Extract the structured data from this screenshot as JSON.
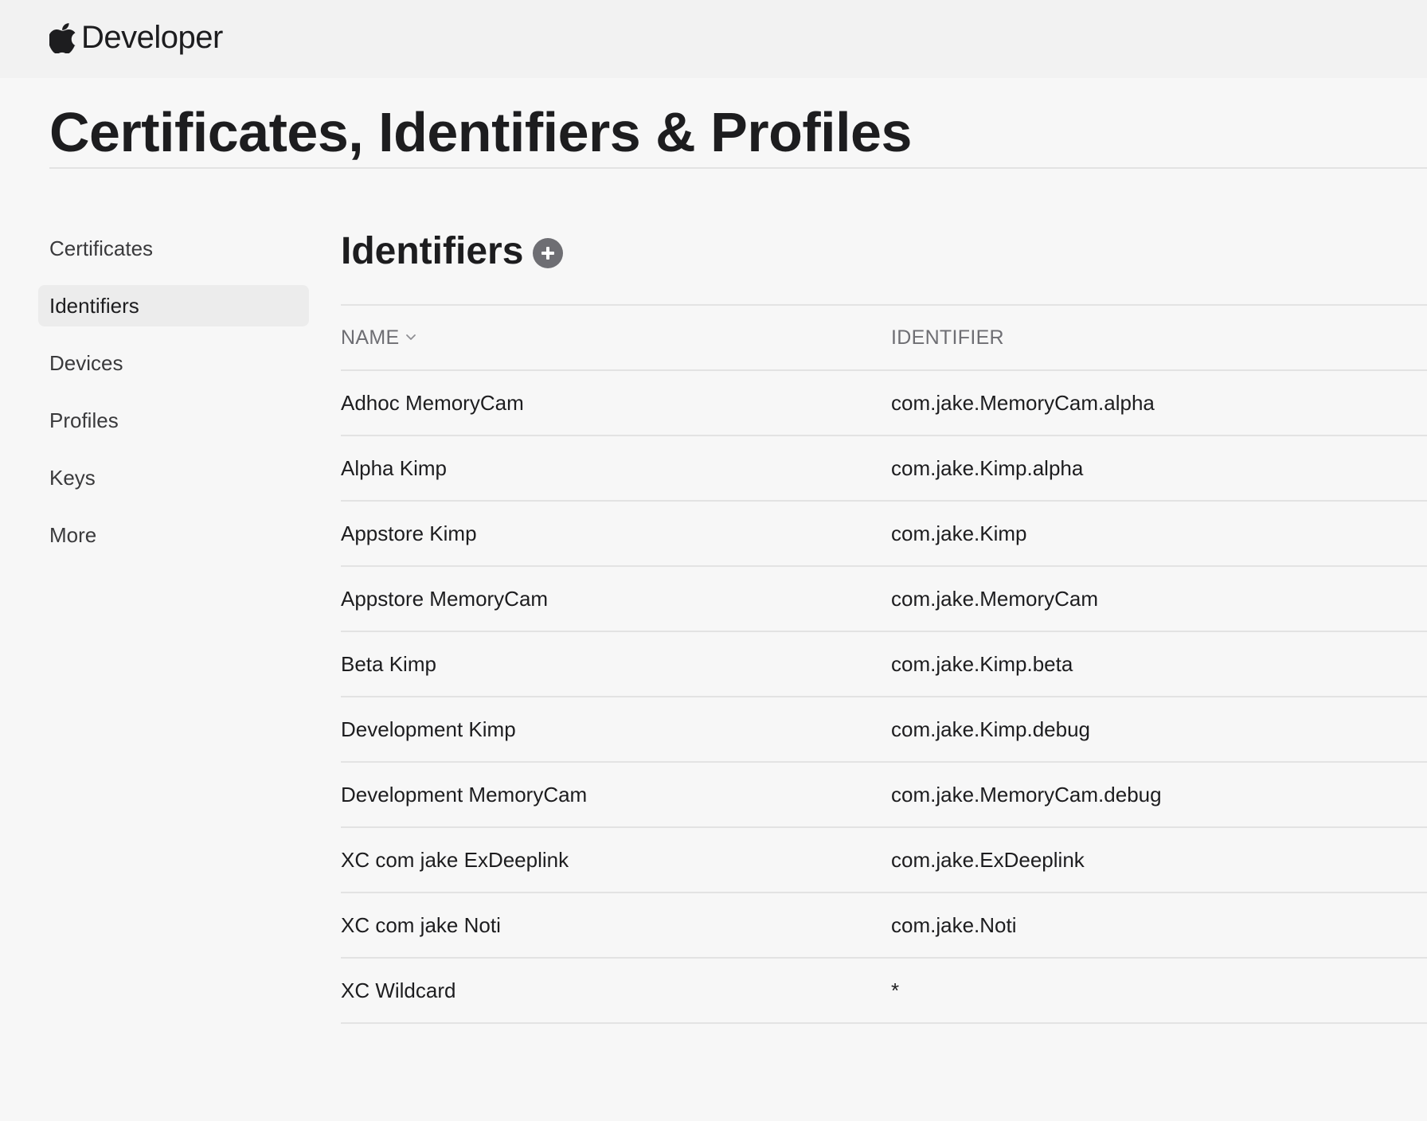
{
  "header": {
    "brand_label": "Developer",
    "brand_icon": "apple-logo-icon"
  },
  "page": {
    "title": "Certificates, Identifiers & Profiles"
  },
  "sidebar": {
    "items": [
      {
        "label": "Certificates",
        "active": false
      },
      {
        "label": "Identifiers",
        "active": true
      },
      {
        "label": "Devices",
        "active": false
      },
      {
        "label": "Profiles",
        "active": false
      },
      {
        "label": "Keys",
        "active": false
      },
      {
        "label": "More",
        "active": false
      }
    ]
  },
  "section": {
    "title": "Identifiers",
    "add_icon": "plus-circle-icon"
  },
  "table": {
    "columns": {
      "name": "NAME",
      "identifier": "IDENTIFIER"
    },
    "sort_icon": "chevron-down-icon",
    "rows": [
      {
        "name": "Adhoc MemoryCam",
        "identifier": "com.jake.MemoryCam.alpha"
      },
      {
        "name": "Alpha Kimp",
        "identifier": "com.jake.Kimp.alpha"
      },
      {
        "name": "Appstore Kimp",
        "identifier": "com.jake.Kimp"
      },
      {
        "name": "Appstore MemoryCam",
        "identifier": "com.jake.MemoryCam"
      },
      {
        "name": "Beta Kimp",
        "identifier": "com.jake.Kimp.beta"
      },
      {
        "name": "Development Kimp",
        "identifier": "com.jake.Kimp.debug"
      },
      {
        "name": "Development MemoryCam",
        "identifier": "com.jake.MemoryCam.debug"
      },
      {
        "name": "XC com jake ExDeeplink",
        "identifier": "com.jake.ExDeeplink"
      },
      {
        "name": "XC com jake Noti",
        "identifier": "com.jake.Noti"
      },
      {
        "name": "XC Wildcard",
        "identifier": "*"
      }
    ]
  },
  "colors": {
    "background": "#f7f7f7",
    "topbar": "#f2f2f2",
    "text": "#1d1d1f",
    "muted": "#6e6e73",
    "divider": "#e3e3e3",
    "active_item": "#ececec"
  }
}
